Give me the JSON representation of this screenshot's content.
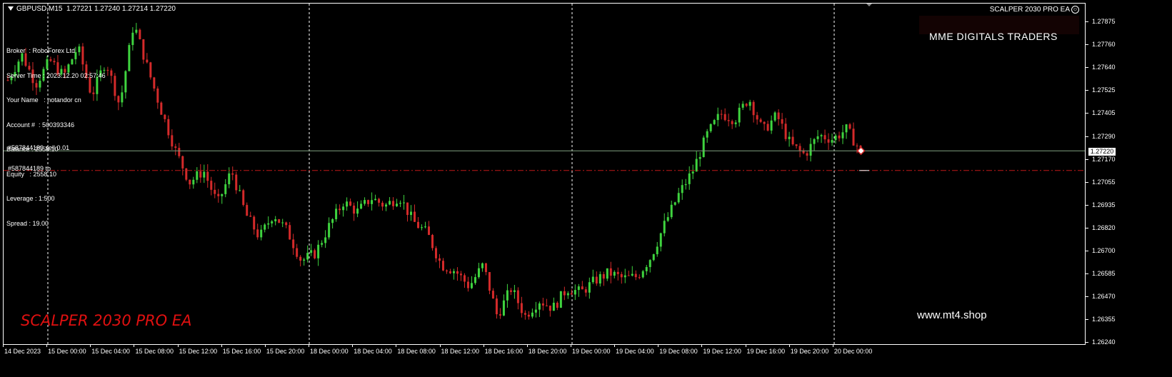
{
  "header": {
    "symbol": "GBPUSD,M15",
    "ohlc": "1.27221 1.27240 1.27214 1.27220",
    "ea_name": "SCALPER 2030 PRO EA"
  },
  "account_info": {
    "lines": [
      "Broker  : RoboForex Ltd",
      "Server Time : 2023.12.20 02:57:46",
      "Your Name   : notandor cn",
      "Account #  : 500393346",
      "Balance : 2558.10",
      "Equity   : 2558.10",
      "Leverage : 1:500",
      "Spread : 19.00"
    ]
  },
  "brand_label": "MME DIGITALS TRADERS",
  "watermark_left": "SCALPER 2030 PRO EA",
  "watermark_right": "www.mt4.shop",
  "orders": {
    "sell": "#587844189 sell 0.01",
    "tp": "#587844189 tp"
  },
  "price_axis": {
    "labels": [
      "1.27875",
      "1.27760",
      "1.27640",
      "1.27525",
      "1.27405",
      "1.27290",
      "1.27170",
      "1.27055",
      "1.26935",
      "1.26820",
      "1.26700",
      "1.26585",
      "1.26470",
      "1.26355",
      "1.26240"
    ],
    "current": "1.27220"
  },
  "time_axis": {
    "labels": [
      "14 Dec 2023",
      "15 Dec 00:00",
      "15 Dec 04:00",
      "15 Dec 08:00",
      "15 Dec 12:00",
      "15 Dec 16:00",
      "15 Dec 20:00",
      "18 Dec 00:00",
      "18 Dec 04:00",
      "18 Dec 08:00",
      "18 Dec 12:00",
      "18 Dec 16:00",
      "18 Dec 20:00",
      "19 Dec 00:00",
      "19 Dec 04:00",
      "19 Dec 08:00",
      "19 Dec 12:00",
      "19 Dec 16:00",
      "19 Dec 20:00",
      "20 Dec 00:00"
    ]
  },
  "colors": {
    "background": "#000000",
    "bull": "#3fd43f",
    "bear": "#d42a2a",
    "grid": "#ffffff",
    "sell_line": "#7f9f7f",
    "tp_line": "#c01818",
    "watermark": "#e01010"
  },
  "chart_data": {
    "type": "candlestick",
    "symbol": "GBPUSD",
    "timeframe": "M15",
    "ylim": [
      1.262,
      1.2792
    ],
    "x": [
      "14 Dec 2023",
      "15 Dec 00:00",
      "15 Dec 04:00",
      "15 Dec 08:00",
      "15 Dec 12:00",
      "15 Dec 16:00",
      "15 Dec 20:00",
      "18 Dec 00:00",
      "18 Dec 04:00",
      "18 Dec 08:00",
      "18 Dec 12:00",
      "18 Dec 16:00",
      "18 Dec 20:00",
      "19 Dec 00:00",
      "19 Dec 04:00",
      "19 Dec 08:00",
      "19 Dec 12:00",
      "19 Dec 16:00",
      "19 Dec 20:00",
      "20 Dec 00:00"
    ],
    "close_path": [
      1.2758,
      1.2771,
      1.2756,
      1.2768,
      1.276,
      1.2775,
      1.275,
      1.2768,
      1.2745,
      1.2787,
      1.2764,
      1.2742,
      1.2722,
      1.2706,
      1.2712,
      1.2695,
      1.2712,
      1.269,
      1.2678,
      1.269,
      1.2681,
      1.2666,
      1.267,
      1.2684,
      1.2696,
      1.2691,
      1.2698,
      1.2694,
      1.2699,
      1.2686,
      1.268,
      1.2664,
      1.2661,
      1.2653,
      1.2664,
      1.2638,
      1.2652,
      1.2638,
      1.2646,
      1.2642,
      1.2652,
      1.265,
      1.2656,
      1.266,
      1.2657,
      1.2658,
      1.2668,
      1.2685,
      1.27,
      1.2712,
      1.273,
      1.2741,
      1.2738,
      1.2749,
      1.2732,
      1.274,
      1.2725,
      1.272,
      1.273,
      1.2728,
      1.2733,
      1.2722
    ],
    "current_price": 1.2722,
    "orders": [
      {
        "label": "#587844189 sell 0.01",
        "price": 1.2722
      },
      {
        "label": "#587844189 tp",
        "price": 1.2712
      }
    ]
  }
}
